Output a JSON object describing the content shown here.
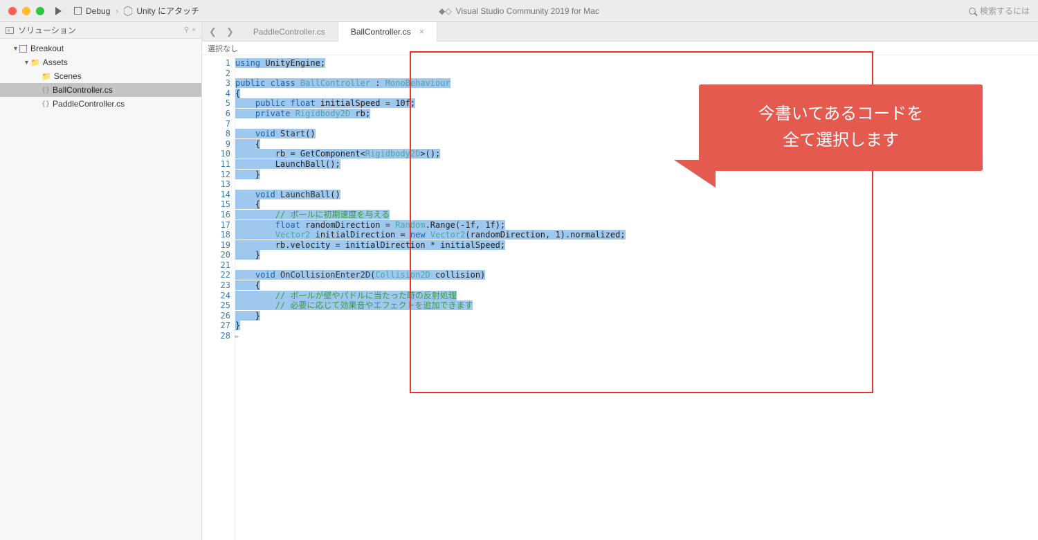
{
  "titlebar": {
    "debug_label": "Debug",
    "unity_attach": "Unity にアタッチ",
    "app_title": "Visual Studio Community 2019 for Mac",
    "search_placeholder": "検索するには"
  },
  "sidebar": {
    "header": "ソリューション",
    "pin_glyph": "⚲",
    "close_glyph": "×",
    "items": [
      {
        "label": "Breakout",
        "type": "solution",
        "indent": 1,
        "arrow": "▼"
      },
      {
        "label": "Assets",
        "type": "folder",
        "indent": 2,
        "arrow": "▼"
      },
      {
        "label": "Scenes",
        "type": "folder",
        "indent": 3,
        "arrow": ""
      },
      {
        "label": "BallController.cs",
        "type": "cs",
        "indent": 3,
        "arrow": "",
        "selected": true
      },
      {
        "label": "PaddleController.cs",
        "type": "cs",
        "indent": 3,
        "arrow": ""
      }
    ]
  },
  "tabs": {
    "prev": "❮",
    "next": "❯",
    "items": [
      {
        "label": "PaddleController.cs",
        "active": false
      },
      {
        "label": "BallController.cs",
        "active": true
      }
    ],
    "close_glyph": "×"
  },
  "breadcrumb": "選択なし",
  "code": {
    "line_count": 28,
    "lines": [
      {
        "n": 1,
        "seg": [
          {
            "t": "using ",
            "c": "kw"
          },
          {
            "t": "UnityEngine;",
            "c": "plain"
          }
        ]
      },
      {
        "n": 2,
        "seg": [
          {
            "t": " ",
            "c": "plain"
          }
        ],
        "nohl": true
      },
      {
        "n": 3,
        "seg": [
          {
            "t": "public class ",
            "c": "kw"
          },
          {
            "t": "BallController",
            "c": "type"
          },
          {
            "t": " : ",
            "c": "plain"
          },
          {
            "t": "MonoBehaviour",
            "c": "type"
          }
        ]
      },
      {
        "n": 4,
        "seg": [
          {
            "t": "{",
            "c": "plain"
          }
        ]
      },
      {
        "n": 5,
        "seg": [
          {
            "t": "    ",
            "c": "plain"
          },
          {
            "t": "public float ",
            "c": "kw"
          },
          {
            "t": "initialSpeed = 10f;",
            "c": "plain"
          }
        ]
      },
      {
        "n": 6,
        "seg": [
          {
            "t": "    ",
            "c": "plain"
          },
          {
            "t": "private ",
            "c": "kw"
          },
          {
            "t": "Rigidbody2D",
            "c": "type"
          },
          {
            "t": " rb;",
            "c": "plain"
          }
        ]
      },
      {
        "n": 7,
        "seg": [
          {
            "t": " ",
            "c": "plain"
          }
        ],
        "nohl": true
      },
      {
        "n": 8,
        "seg": [
          {
            "t": "    ",
            "c": "plain"
          },
          {
            "t": "void ",
            "c": "kw"
          },
          {
            "t": "Start",
            "c": "method"
          },
          {
            "t": "()",
            "c": "plain"
          }
        ]
      },
      {
        "n": 9,
        "seg": [
          {
            "t": "    {",
            "c": "plain"
          }
        ]
      },
      {
        "n": 10,
        "seg": [
          {
            "t": "        rb = GetComponent<",
            "c": "plain"
          },
          {
            "t": "Rigidbody2D",
            "c": "type"
          },
          {
            "t": ">();",
            "c": "plain"
          }
        ]
      },
      {
        "n": 11,
        "seg": [
          {
            "t": "        LaunchBall();",
            "c": "plain"
          }
        ]
      },
      {
        "n": 12,
        "seg": [
          {
            "t": "    }",
            "c": "plain"
          }
        ]
      },
      {
        "n": 13,
        "seg": [
          {
            "t": " ",
            "c": "plain"
          }
        ],
        "nohl": true
      },
      {
        "n": 14,
        "seg": [
          {
            "t": "    ",
            "c": "plain"
          },
          {
            "t": "void ",
            "c": "kw"
          },
          {
            "t": "LaunchBall",
            "c": "method"
          },
          {
            "t": "()",
            "c": "plain"
          }
        ]
      },
      {
        "n": 15,
        "seg": [
          {
            "t": "    {",
            "c": "plain"
          }
        ]
      },
      {
        "n": 16,
        "seg": [
          {
            "t": "        ",
            "c": "plain"
          },
          {
            "t": "// ボールに初期速度を与える",
            "c": "comment"
          }
        ]
      },
      {
        "n": 17,
        "seg": [
          {
            "t": "        ",
            "c": "plain"
          },
          {
            "t": "float ",
            "c": "kw"
          },
          {
            "t": "randomDirection = ",
            "c": "plain"
          },
          {
            "t": "Random",
            "c": "type"
          },
          {
            "t": ".Range(-1f, 1f);",
            "c": "plain"
          }
        ]
      },
      {
        "n": 18,
        "seg": [
          {
            "t": "        ",
            "c": "plain"
          },
          {
            "t": "Vector2",
            "c": "type"
          },
          {
            "t": " initialDirection = ",
            "c": "plain"
          },
          {
            "t": "new ",
            "c": "kw"
          },
          {
            "t": "Vector2",
            "c": "type"
          },
          {
            "t": "(randomDirection, 1).normalized;",
            "c": "plain"
          }
        ]
      },
      {
        "n": 19,
        "seg": [
          {
            "t": "        rb.velocity = initialDirection * initialSpeed;",
            "c": "plain"
          }
        ]
      },
      {
        "n": 20,
        "seg": [
          {
            "t": "    }",
            "c": "plain"
          }
        ]
      },
      {
        "n": 21,
        "seg": [
          {
            "t": " ",
            "c": "plain"
          }
        ],
        "nohl": true
      },
      {
        "n": 22,
        "seg": [
          {
            "t": "    ",
            "c": "plain"
          },
          {
            "t": "void ",
            "c": "kw"
          },
          {
            "t": "OnCollisionEnter2D",
            "c": "method"
          },
          {
            "t": "(",
            "c": "plain"
          },
          {
            "t": "Collision2D",
            "c": "type"
          },
          {
            "t": " collision)",
            "c": "plain"
          }
        ]
      },
      {
        "n": 23,
        "seg": [
          {
            "t": "    {",
            "c": "plain"
          }
        ]
      },
      {
        "n": 24,
        "seg": [
          {
            "t": "        ",
            "c": "plain"
          },
          {
            "t": "// ボールが壁やパドルに当たった時の反射処理",
            "c": "comment"
          }
        ]
      },
      {
        "n": 25,
        "seg": [
          {
            "t": "        ",
            "c": "plain"
          },
          {
            "t": "// 必要に応じて効果音やエフェクトを追加できます",
            "c": "comment"
          }
        ]
      },
      {
        "n": 26,
        "seg": [
          {
            "t": "    }",
            "c": "plain"
          }
        ]
      },
      {
        "n": 27,
        "seg": [
          {
            "t": "}",
            "c": "plain"
          }
        ]
      },
      {
        "n": 28,
        "seg": [],
        "nohl": true,
        "pencil": true
      }
    ]
  },
  "callout": {
    "line1": "今書いてあるコードを",
    "line2": "全て選択します"
  }
}
